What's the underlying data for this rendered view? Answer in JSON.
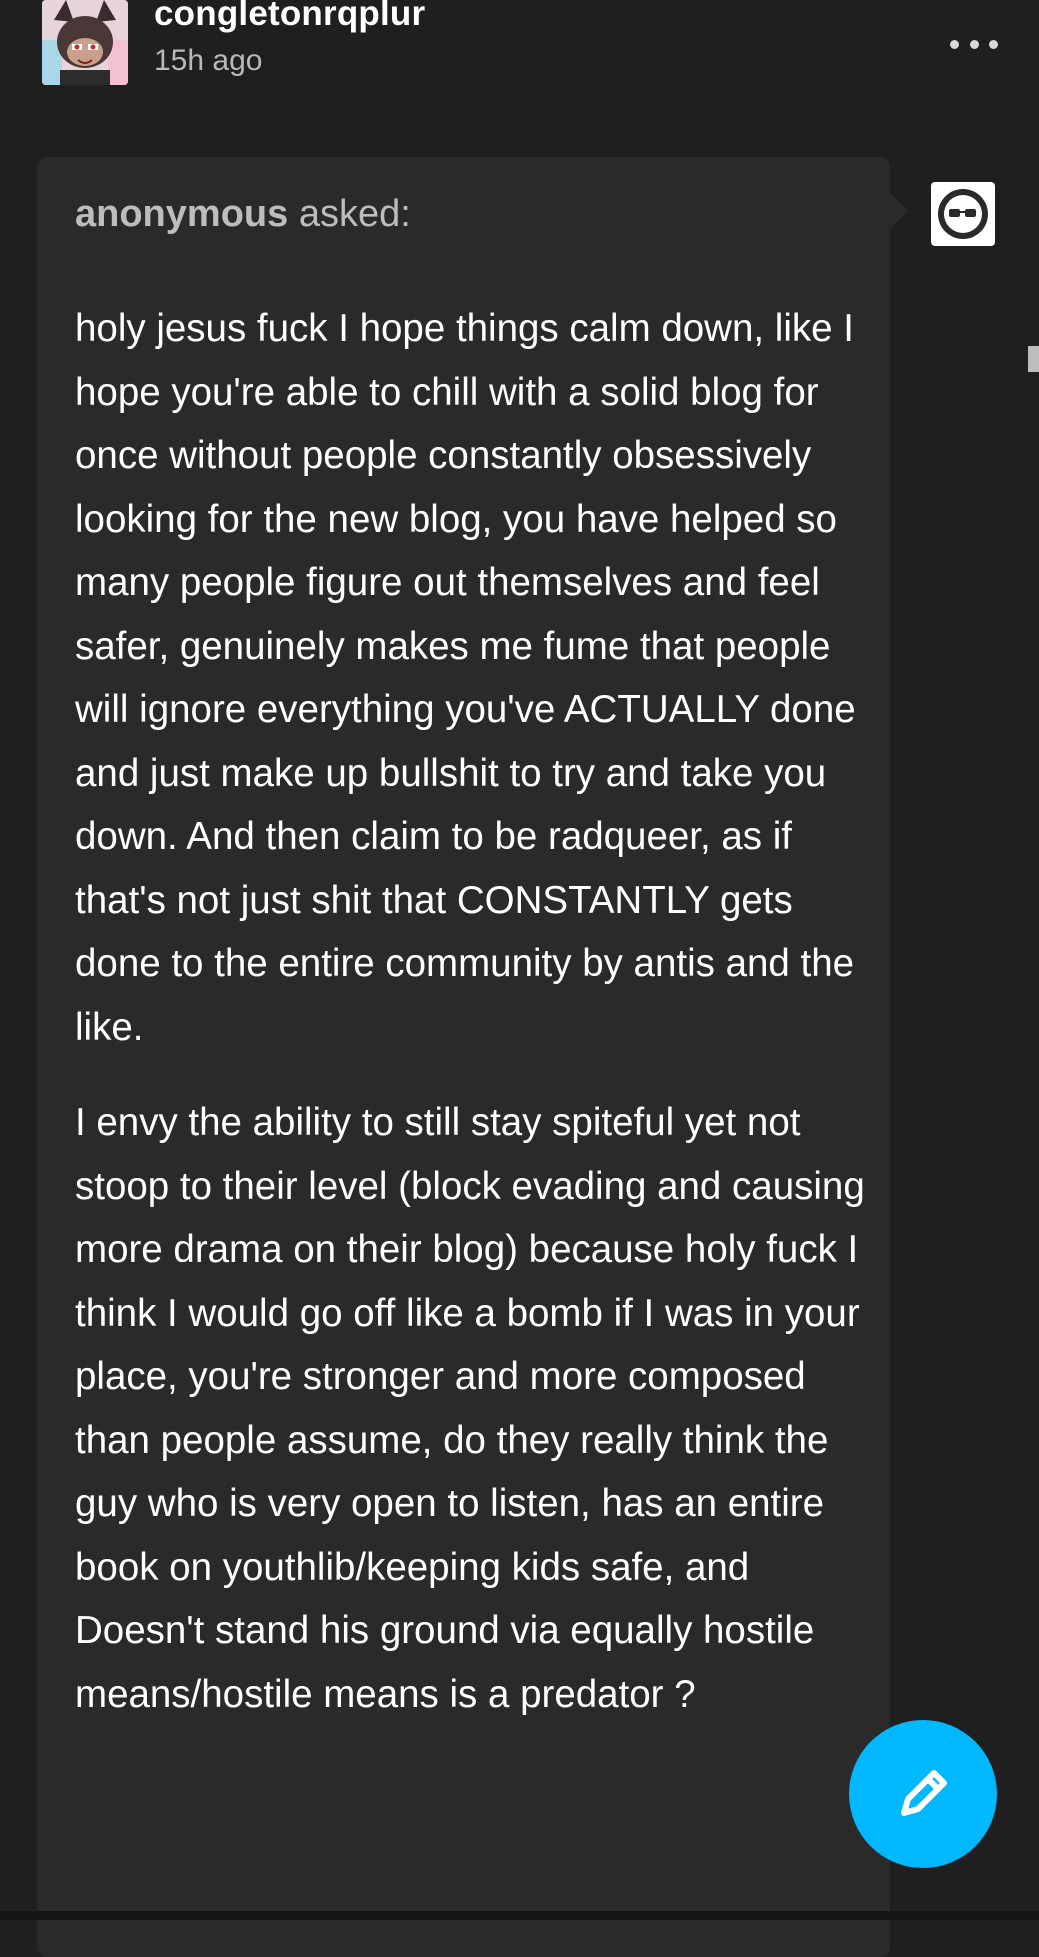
{
  "post": {
    "username": "congletonrqplur",
    "timestamp": "15h ago",
    "more_menu_icon": "more-horizontal-icon"
  },
  "ask": {
    "asker": "anonymous",
    "asked_label": "asked:",
    "asker_avatar_icon": "anonymous-sunglasses-icon",
    "paragraphs": [
      "holy jesus fuck I hope things calm down, like I hope you're able to chill with a solid blog for once without people constantly obsessively looking for the new blog, you have helped so many people figure out themselves and feel safer, genuinely makes me fume that people will ignore everything you've ACTUALLY done and just make up bullshit to try and take you down. And then claim to be radqueer, as if that's not just shit that CONSTANTLY gets done to the entire community by antis and the like.",
      "I envy the ability to still stay spiteful yet not stoop to their level (block evading and causing more drama on their blog) because holy fuck I think I would go off like a bomb if I was in your place, you're stronger and more composed than people assume, do they really think the guy who is very open to listen, has an entire book on youthlib/keeping kids safe, and Doesn't stand his ground via equally hostile means/hostile means is a predator ?"
    ]
  },
  "compose": {
    "icon": "pencil-icon"
  },
  "colors": {
    "background": "#1f1f1f",
    "card": "#2a2a2a",
    "accent": "#00b8ff",
    "muted_text": "#b9b9b9"
  }
}
